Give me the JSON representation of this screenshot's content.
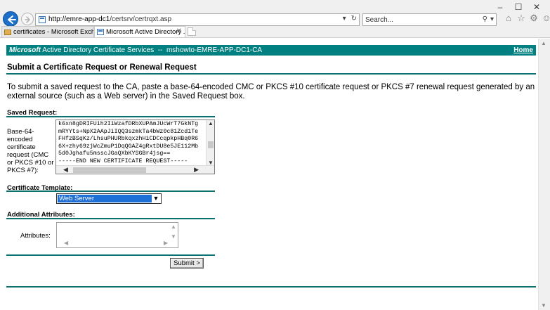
{
  "browser": {
    "url_host": "http://emre-app-dc1",
    "url_path": "/certsrv/certrqxt.asp",
    "search_placeholder": "Search...",
    "window_controls": {
      "minimize": "–",
      "maximize": "☐",
      "close": "✕"
    },
    "tabs": [
      {
        "label": "certificates - Microsoft Exchange ...",
        "active": false
      },
      {
        "label": "Microsoft Active Directory ...",
        "active": true
      }
    ]
  },
  "banner": {
    "brand": "Microsoft",
    "service": "Active Directory Certificate Services",
    "separator": "--",
    "ca_name": "mshowto-EMRE-APP-DC1-CA",
    "home_link": "Home"
  },
  "page": {
    "title": "Submit a Certificate Request or Renewal Request",
    "intro": "To submit a saved request to the CA, paste a base-64-encoded CMC or PKCS #10 certificate request or PKCS #7 renewal request generated by an external source (such as a Web server) in the Saved Request box."
  },
  "saved_request": {
    "section_label": "Saved Request:",
    "field_label": "Base-64-encoded certificate request (CMC or PKCS #10 or PKCS #7):",
    "lines": [
      "k6xn8gDRIFUih2IiWzafDRbXUPAmJUcWrT7GkNTg",
      "mRYYts+NpX2AApJiIQQ3szmkTa4bWz0c81Zcd1Te",
      "FHfzBSqKz/LhsuPHURbkqxzhHiCDCcqpkpHBq0R6",
      "6X+zhy69zjWcZmuP1DqQGAZ4gRxtDU8e5JE112Mb",
      "5d0Jghafu5msscJGaQXbKYSGBr4jsg==",
      "-----END NEW CERTIFICATE REQUEST-----"
    ]
  },
  "template": {
    "section_label": "Certificate Template:",
    "selected": "Web Server"
  },
  "attributes": {
    "section_label": "Additional Attributes:",
    "field_label": "Attributes:",
    "value": ""
  },
  "submit_label": "Submit >"
}
